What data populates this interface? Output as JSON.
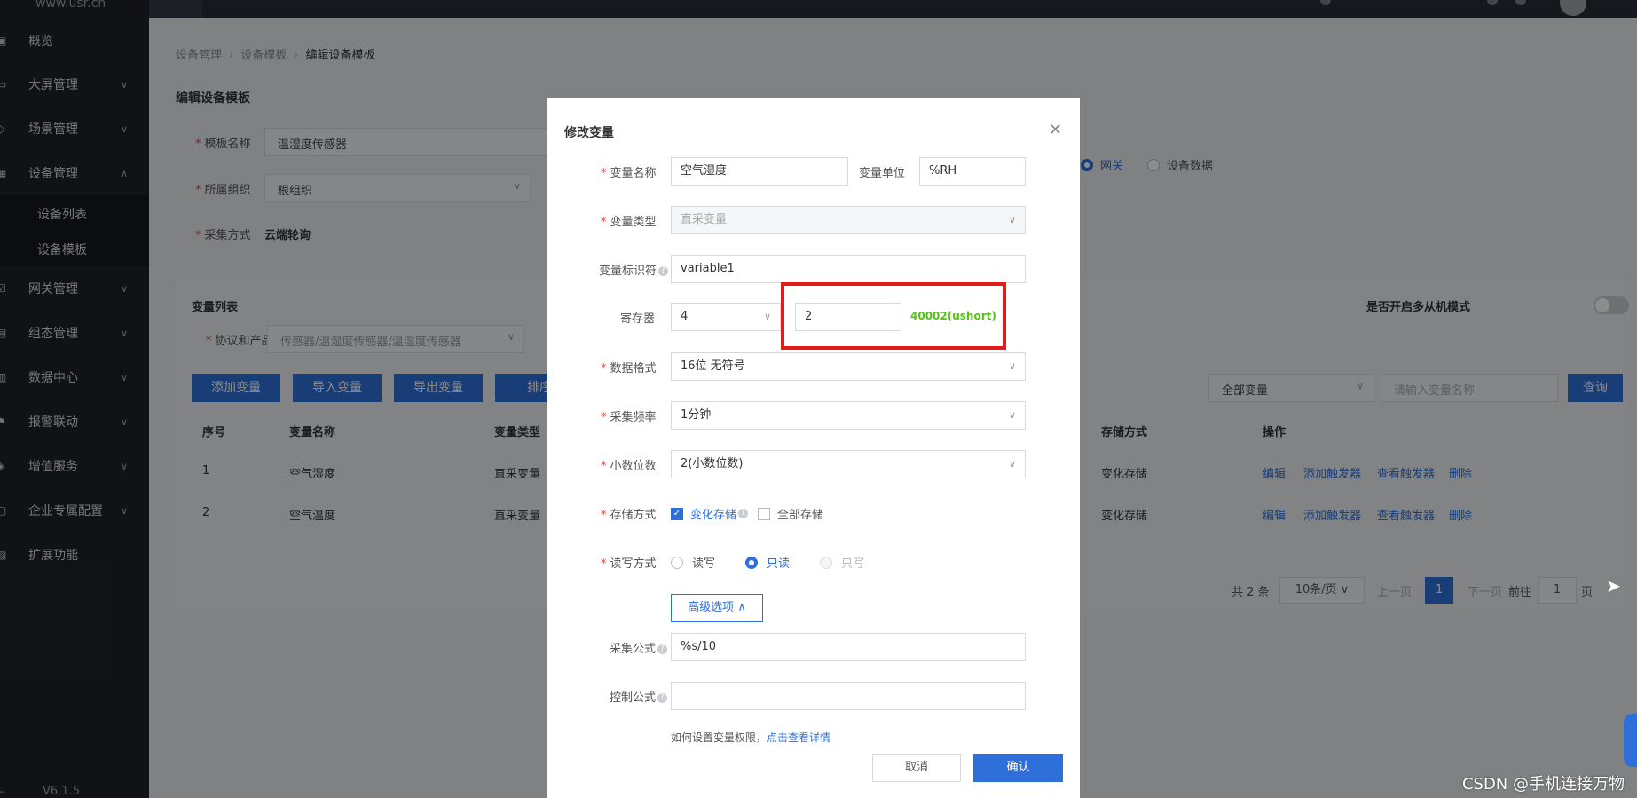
{
  "sidebar": {
    "brand": "www.usr.cn",
    "items": [
      {
        "label": "概览",
        "icon": "overview-icon"
      },
      {
        "label": "大屏管理",
        "icon": "screen-icon"
      },
      {
        "label": "场景管理",
        "icon": "scene-icon"
      },
      {
        "label": "设备管理",
        "icon": "device-icon"
      },
      {
        "label": "网关管理",
        "icon": "gateway-icon"
      },
      {
        "label": "组态管理",
        "icon": "config-icon"
      },
      {
        "label": "数据中心",
        "icon": "data-icon"
      },
      {
        "label": "报警联动",
        "icon": "alarm-icon"
      },
      {
        "label": "增值服务",
        "icon": "value-icon"
      },
      {
        "label": "企业专属配置",
        "icon": "enterprise-icon"
      },
      {
        "label": "扩展功能",
        "icon": "extend-icon"
      }
    ],
    "subitems": [
      "设备列表",
      "设备模板"
    ],
    "version": "V6.1.5"
  },
  "breadcrumb": [
    "设备管理",
    "设备模板",
    "编辑设备模板"
  ],
  "page_title": "编辑设备模板",
  "template_form": {
    "name_label": "模板名称",
    "name_value": "温湿度传感器",
    "org_label": "所属组织",
    "org_value": "根组织",
    "collect_label": "采集方式",
    "collect_value": "云端轮询",
    "source_options": [
      "网关",
      "设备数据"
    ]
  },
  "variable_list": {
    "title": "变量列表",
    "protocol_label": "协议和产品",
    "protocol_value": "传感器/温湿度传感器/温湿度传感器",
    "slave_mode_label": "是否开启多从机模式",
    "buttons": [
      "添加变量",
      "导入变量",
      "导出变量",
      "排序"
    ],
    "filter_value": "全部变量",
    "search_placeholder": "请输入变量名称",
    "query_label": "查询",
    "columns": [
      "序号",
      "变量名称",
      "变量类型",
      "存储方式",
      "操作"
    ],
    "rows": [
      {
        "no": "1",
        "name": "空气湿度",
        "type": "直采变量",
        "storage": "变化存储"
      },
      {
        "no": "2",
        "name": "空气温度",
        "type": "直采变量",
        "storage": "变化存储"
      }
    ],
    "actions": [
      "编辑",
      "添加触发器",
      "查看触发器",
      "删除"
    ],
    "pagination": {
      "total": "共 2 条",
      "page_size": "10条/页",
      "prev": "上一页",
      "current": "1",
      "next": "下一页",
      "goto": "前往",
      "goto_value": "1",
      "page_unit": "页"
    }
  },
  "modal": {
    "title": "修改变量",
    "var_name_label": "变量名称",
    "var_name_value": "空气湿度",
    "unit_label": "变量单位",
    "unit_value": "%RH",
    "type_label": "变量类型",
    "type_value": "直采变量",
    "identifier_label": "变量标识符",
    "identifier_value": "variable1",
    "register_label": "寄存器",
    "register_type": "4",
    "register_addr": "2",
    "register_hint": "40002(ushort)",
    "format_label": "数据格式",
    "format_value": "16位 无符号",
    "freq_label": "采集频率",
    "freq_value": "1分钟",
    "decimal_label": "小数位数",
    "decimal_value": "2(小数位数)",
    "storage_label": "存储方式",
    "storage_opt1": "变化存储",
    "storage_opt2": "全部存储",
    "rw_label": "读写方式",
    "rw_opt1": "读写",
    "rw_opt2": "只读",
    "rw_opt3": "只写",
    "advanced_label": "高级选项",
    "collect_formula_label": "采集公式",
    "collect_formula_value": "%s/10",
    "control_formula_label": "控制公式",
    "control_formula_value": "",
    "perm_note": "如何设置变量权限，",
    "perm_link": "点击查看详情",
    "cancel_label": "取消",
    "confirm_label": "确认"
  },
  "watermark": "CSDN @手机连接万物",
  "colors": {
    "primary": "#2f6fd9",
    "highlight": "#e21b1b",
    "hint": "#52c41a"
  }
}
